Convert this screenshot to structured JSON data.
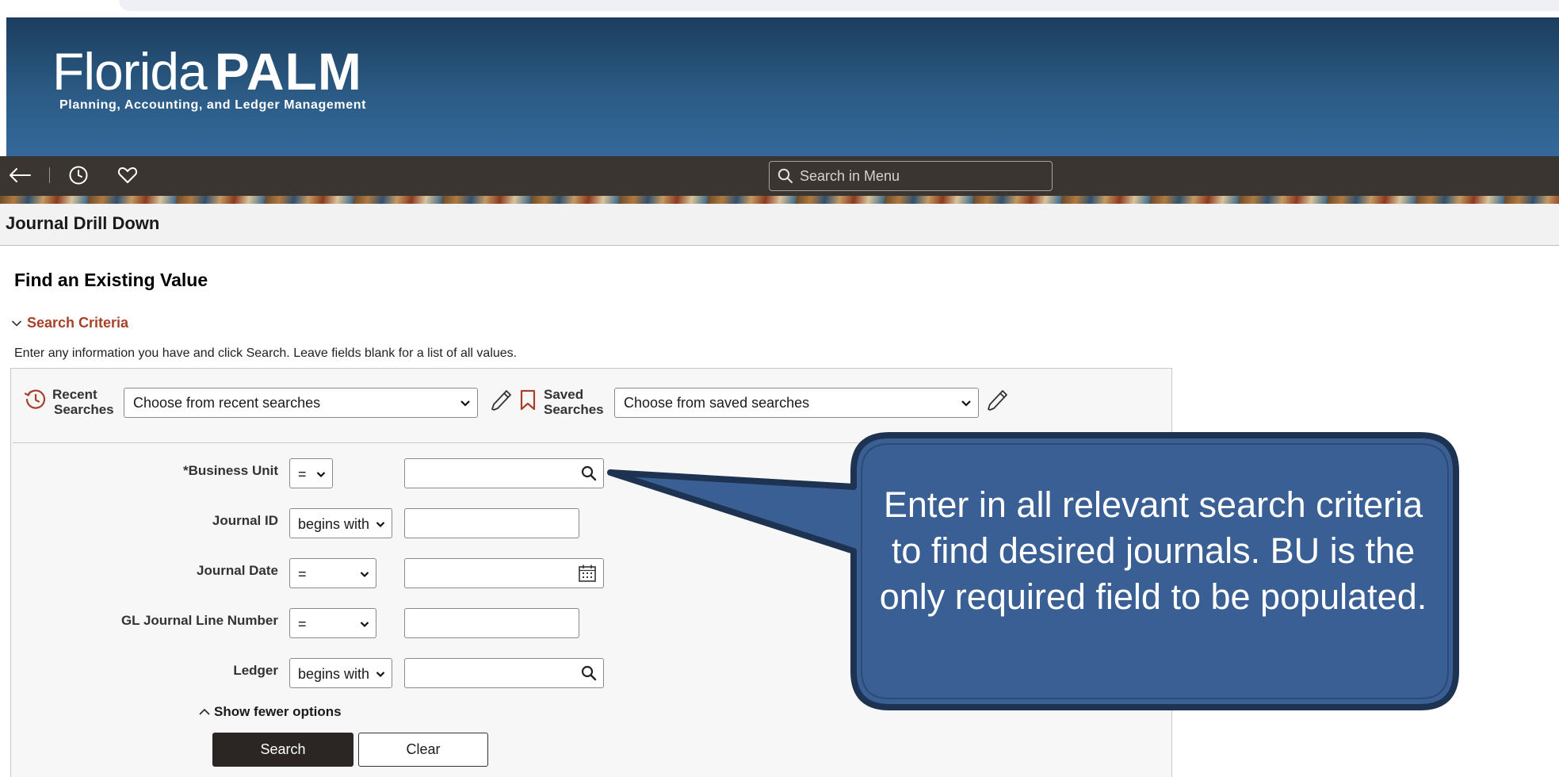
{
  "app": {
    "logo_word1": "Florida",
    "logo_word2": "PALM",
    "logo_tagline": "Planning, Accounting, and Ledger Management"
  },
  "navbar": {
    "search_placeholder": "Search in Menu",
    "icons": [
      "back-arrow-icon",
      "history-clock-icon",
      "favorites-heart-icon",
      "search-icon"
    ]
  },
  "page": {
    "title": "Journal Drill Down",
    "section_title": "Find an Existing Value",
    "criteria_toggle": "Search Criteria",
    "instructions": "Enter any information you have and click Search. Leave fields blank for a list of all values."
  },
  "saved_searches": {
    "recent_label_1": "Recent",
    "recent_label_2": "Searches",
    "recent_value": "Choose from recent searches",
    "saved_label_1": "Saved",
    "saved_label_2": "Searches",
    "saved_value": "Choose from saved searches"
  },
  "fields": [
    {
      "label": "*Business Unit",
      "operator": "=",
      "value": ""
    },
    {
      "label": "Journal ID",
      "operator": "begins with",
      "value": ""
    },
    {
      "label": "Journal Date",
      "operator": "=",
      "value": ""
    },
    {
      "label": "GL Journal Line Number",
      "operator": "=",
      "value": ""
    },
    {
      "label": "Ledger",
      "operator": "begins with",
      "value": ""
    }
  ],
  "actions": {
    "show_fewer": "Show fewer options",
    "search": "Search",
    "clear": "Clear"
  },
  "callout": {
    "text": "Enter in all relevant search criteria to find desired journals. BU is the only required field to be populated."
  },
  "colors": {
    "banner_top": "#1c3d5e",
    "banner_bottom": "#35699a",
    "navbar": "#3a3531",
    "criteria_accent": "#a8402a",
    "callout_fill": "#3a5f94",
    "callout_border": "#1e3352",
    "search_button": "#2b2623"
  }
}
